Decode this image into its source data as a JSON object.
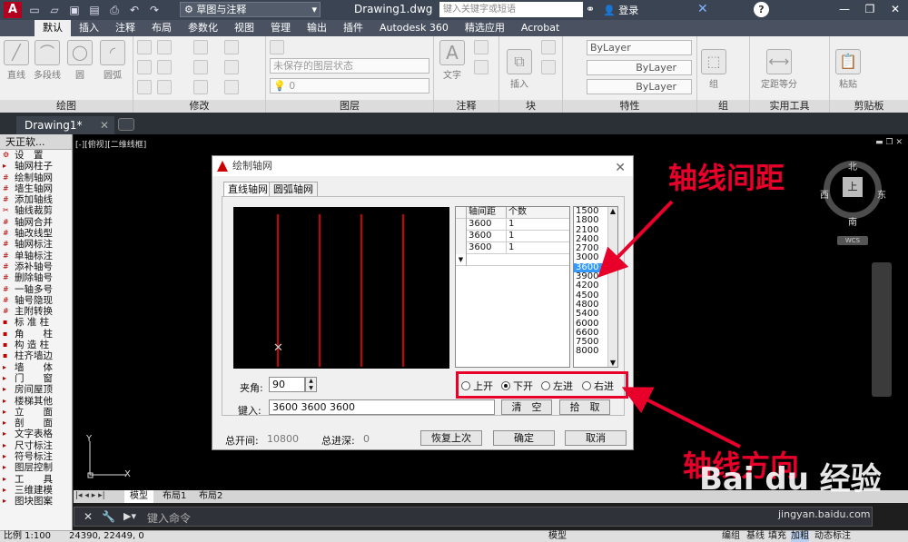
{
  "titlebar": {
    "workspace": "草图与注释",
    "document": "Drawing1.dwg",
    "search_placeholder": "键入关键字或短语",
    "login": "登录"
  },
  "ribbon_tabs": [
    "默认",
    "插入",
    "注释",
    "布局",
    "参数化",
    "视图",
    "管理",
    "输出",
    "插件",
    "Autodesk 360",
    "精选应用",
    "Acrobat"
  ],
  "ribbon": {
    "draw": {
      "title": "绘图",
      "tools": [
        "直线",
        "多段线",
        "圆",
        "圆弧"
      ]
    },
    "modify": {
      "title": "修改"
    },
    "layer": {
      "title": "图层",
      "state": "未保存的图层状态",
      "current": "0"
    },
    "annotation": {
      "title": "注释",
      "tool": "文字"
    },
    "block": {
      "title": "块",
      "tool": "插入"
    },
    "properties": {
      "title": "特性",
      "color": "ByLayer",
      "linetype": "ByLayer",
      "lineweight": "ByLayer"
    },
    "group": {
      "title": "组",
      "tool": "组"
    },
    "utilities": {
      "title": "实用工具",
      "tool": "定距等分"
    },
    "clipboard": {
      "title": "剪贴板",
      "tool": "粘贴"
    }
  },
  "doc_tab": "Drawing1*",
  "tpanel": {
    "header": "天正软...",
    "items": [
      "设　置",
      "轴网柱子",
      "绘制轴网",
      "墙生轴网",
      "添加轴线",
      "轴线裁剪",
      "轴网合并",
      "轴改线型",
      "轴网标注",
      "单轴标注",
      "添补轴号",
      "删除轴号",
      "一轴多号",
      "轴号隐现",
      "主附转换",
      "标 准 柱",
      "角　　柱",
      "构 造 柱",
      "柱齐墙边",
      "墙　　体",
      "门　　窗",
      "房间屋顶",
      "楼梯其他",
      "立　　面",
      "剖　　面",
      "文字表格",
      "尺寸标注",
      "符号标注",
      "图层控制",
      "工　　具",
      "三维建模",
      "图块图案"
    ]
  },
  "viewport_label": "[-][俯视][二维线框]",
  "viewcube": {
    "north": "北",
    "south": "南",
    "east": "东",
    "west": "西",
    "top": "上",
    "wcs": "WCS"
  },
  "layout_tabs": [
    "模型",
    "布局1",
    "布局2"
  ],
  "command_placeholder": "键入命令",
  "statusbar": {
    "scale": "比例 1:100",
    "coords": "24390, 22449, 0",
    "model": "模型",
    "right_items": [
      "编组",
      "基线",
      "填充",
      "加粗",
      "动态标注"
    ]
  },
  "dialog": {
    "title": "绘制轴网",
    "tabs": [
      "直线轴网",
      "圆弧轴网"
    ],
    "grid_headers": [
      "轴间距",
      "个数"
    ],
    "grid_rows": [
      [
        "3600",
        "1"
      ],
      [
        "3600",
        "1"
      ],
      [
        "3600",
        "1"
      ]
    ],
    "spacing_values": [
      "1500",
      "1800",
      "2100",
      "2400",
      "2700",
      "3000",
      "3600",
      "3900",
      "4200",
      "4500",
      "4800",
      "5400",
      "6000",
      "6600",
      "7500",
      "8000"
    ],
    "selected_spacing": "3600",
    "angle_label": "夹角:",
    "angle_value": "90",
    "input_label": "键入:",
    "input_value": "3600  3600  3600",
    "clear_button": "清　空",
    "pick_button": "拾　取",
    "radios": [
      "上开",
      "下开",
      "左进",
      "右进"
    ],
    "selected_radio": "下开",
    "total_width_label": "总开间:",
    "total_width_value": "10800",
    "total_depth_label": "总进深:",
    "total_depth_value": "0",
    "restore_button": "恢复上次",
    "ok_button": "确定",
    "cancel_button": "取消"
  },
  "annotations": {
    "spacing": "轴线间距",
    "direction": "轴线方向"
  },
  "watermark": {
    "brand": "Bai du 经验",
    "url": "jingyan.baidu.com"
  },
  "colors": {
    "annotation": "#e8002a",
    "axis_line": "#cc0000",
    "selection": "#3399ff"
  }
}
